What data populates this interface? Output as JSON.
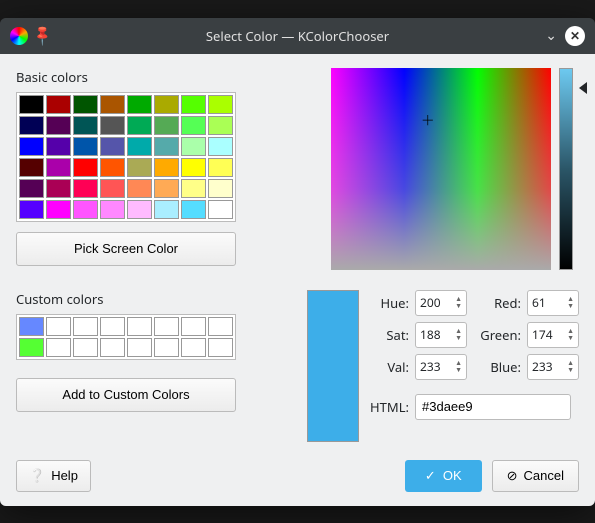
{
  "window": {
    "title": "Select Color — KColorChooser"
  },
  "basic_colors": {
    "label": "Basic colors",
    "swatches": [
      "#000000",
      "#aa0000",
      "#005500",
      "#aa5500",
      "#00aa00",
      "#aaaa00",
      "#55ff00",
      "#aaff00",
      "#000055",
      "#550055",
      "#005555",
      "#555555",
      "#00aa55",
      "#55aa55",
      "#55ff55",
      "#aaff55",
      "#0000ff",
      "#5500aa",
      "#0055aa",
      "#5555aa",
      "#00aaaa",
      "#55aaaa",
      "#aaffaa",
      "#aaffff",
      "#550000",
      "#aa00aa",
      "#ff0000",
      "#ff5500",
      "#aaaa55",
      "#ffaa00",
      "#ffff00",
      "#ffff55",
      "#550055",
      "#aa0055",
      "#ff0055",
      "#ff5555",
      "#ff8855",
      "#ffaa55",
      "#ffff88",
      "#ffffcc",
      "#5500ff",
      "#ff00ff",
      "#ff55ff",
      "#ff88ff",
      "#ffbbff",
      "#aaeeff",
      "#55ddff",
      "#ffffff"
    ]
  },
  "pick_screen_label": "Pick Screen Color",
  "custom_colors": {
    "label": "Custom colors",
    "swatches": [
      "#6688ff",
      "#ffffff",
      "#ffffff",
      "#ffffff",
      "#ffffff",
      "#ffffff",
      "#ffffff",
      "#ffffff",
      "#55ff33",
      "#ffffff",
      "#ffffff",
      "#ffffff",
      "#ffffff",
      "#ffffff",
      "#ffffff",
      "#ffffff"
    ]
  },
  "add_custom_label": "Add to Custom Colors",
  "preview_color": "#3daee9",
  "fields": {
    "hue_label": "Hue:",
    "hue": "200",
    "sat_label": "Sat:",
    "sat": "188",
    "val_label": "Val:",
    "val": "233",
    "red_label": "Red:",
    "red": "61",
    "green_label": "Green:",
    "green": "174",
    "blue_label": "Blue:",
    "blue": "233",
    "html_label": "HTML:",
    "html": "#3daee9"
  },
  "buttons": {
    "help": "Help",
    "ok": "OK",
    "cancel": "Cancel"
  }
}
